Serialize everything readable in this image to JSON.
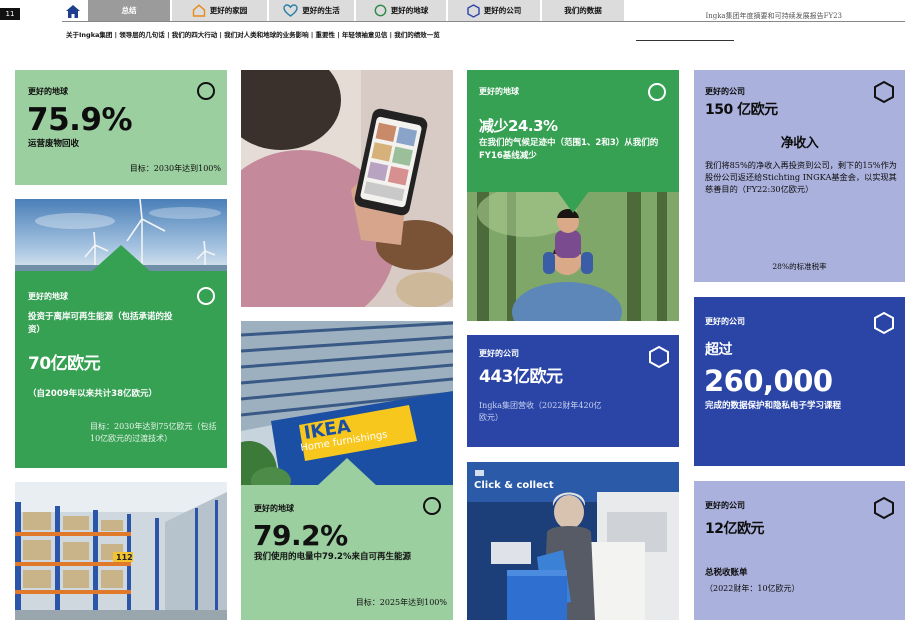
{
  "page_number": "11",
  "report_title": "Ingka集团年度摘要和可持续发展报告FY23",
  "nav": {
    "tabs": [
      {
        "label": "总结",
        "icon": "none",
        "active": true
      },
      {
        "label": "更好的家园",
        "icon": "house-outline-icon"
      },
      {
        "label": "更好的生活",
        "icon": "heart-outline-icon"
      },
      {
        "label": "更好的地球",
        "icon": "circle-outline-icon"
      },
      {
        "label": "更好的公司",
        "icon": "hexagon-outline-icon"
      },
      {
        "label": "我们的数据",
        "icon": "none"
      }
    ]
  },
  "subnav": "关于Ingka集团 | 领导层的几句话 | 我们的四大行动 | 我们对人类和地球的业务影响 | 重要性 | 年轻领袖意见信 | 我们的绩效一览",
  "cards": {
    "recycle": {
      "label": "更好的地球",
      "value": "75.9%",
      "desc": "运营废物回收",
      "note": "目标：2030年达到100%"
    },
    "renew_invest": {
      "label": "更好的地球",
      "desc": "投资于离岸可再生能源（包括承诺的投资）",
      "value": "70亿欧元",
      "sub": "（自2009年以来共计38亿欧元）",
      "note": "目标：2030年达到75亿欧元（包括10亿欧元的过渡技术）"
    },
    "electricity": {
      "label": "更好的地球",
      "value": "79.2%",
      "desc": "我们使用的电量中79.2%来自可再生能源",
      "note": "目标：2025年达到100%"
    },
    "climate": {
      "label": "更好的地球",
      "value": "减少24.3%",
      "desc": "在我们的气候足迹中（范围1、2和3）从我们的FY16基线减少"
    },
    "revenue": {
      "label": "更好的公司",
      "value": "443亿欧元",
      "note": "Ingka集团营收（2022财年420亿欧元）"
    },
    "net_income": {
      "label": "更好的公司",
      "value": "150 亿欧元",
      "subtitle": "净收入",
      "body": "我们将85%的净收入再投资到公司，剩下的15%作为股份公司返还给Stichting INGKA基金会，以实现其慈善目的（FY22:30亿欧元）",
      "note": "28%的标准税率"
    },
    "training": {
      "label": "更好的公司",
      "prefix": "超过",
      "value": "260,000",
      "desc": "完成的数据保护和隐私电子学习课程"
    },
    "tax": {
      "label": "更好的公司",
      "value": "12亿欧元",
      "desc": "总税收账单",
      "note": "（2022财年：10亿欧元）"
    }
  },
  "photos": {
    "store_sign": "IKEA",
    "store_sign_sub": "Home furnishings",
    "rack_number": "112",
    "click_collect": "Click & collect"
  },
  "colors": {
    "light_green": "#9bcf9f",
    "green": "#36a053",
    "blue": "#2a45a6",
    "lavender": "#aab1dc",
    "nav_active": "#9b9b9b",
    "nav_tab": "#dcdcdc"
  }
}
